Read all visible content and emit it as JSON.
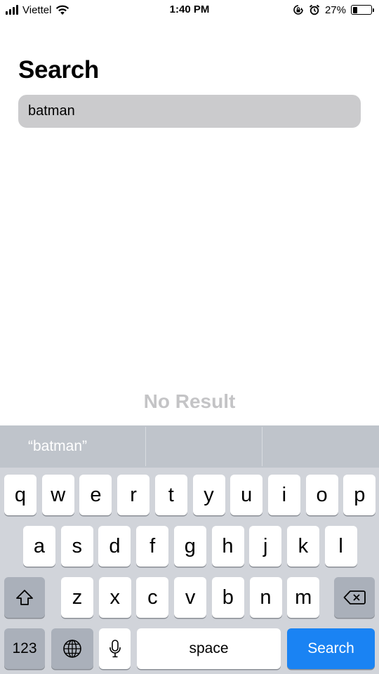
{
  "status_bar": {
    "carrier": "Viettel",
    "time": "1:40 PM",
    "battery_percent_label": "27%",
    "battery_level": 0.27,
    "icons": [
      "signal-icon",
      "wifi-icon",
      "rotation-lock-icon",
      "alarm-icon",
      "battery-icon"
    ]
  },
  "header": {
    "title": "Search"
  },
  "search": {
    "value": "batman"
  },
  "results": {
    "empty_message": "No Result"
  },
  "keyboard": {
    "suggestions": [
      "“batman”",
      "",
      ""
    ],
    "row1": [
      "q",
      "w",
      "e",
      "r",
      "t",
      "y",
      "u",
      "i",
      "o",
      "p"
    ],
    "row2": [
      "a",
      "s",
      "d",
      "f",
      "g",
      "h",
      "j",
      "k",
      "l"
    ],
    "row3": [
      "z",
      "x",
      "c",
      "v",
      "b",
      "n",
      "m"
    ],
    "numbers_label": "123",
    "space_label": "space",
    "return_label": "Search",
    "icons": [
      "shift-icon",
      "backspace-icon",
      "globe-icon",
      "microphone-icon"
    ],
    "return_color": "#1a83f3"
  }
}
